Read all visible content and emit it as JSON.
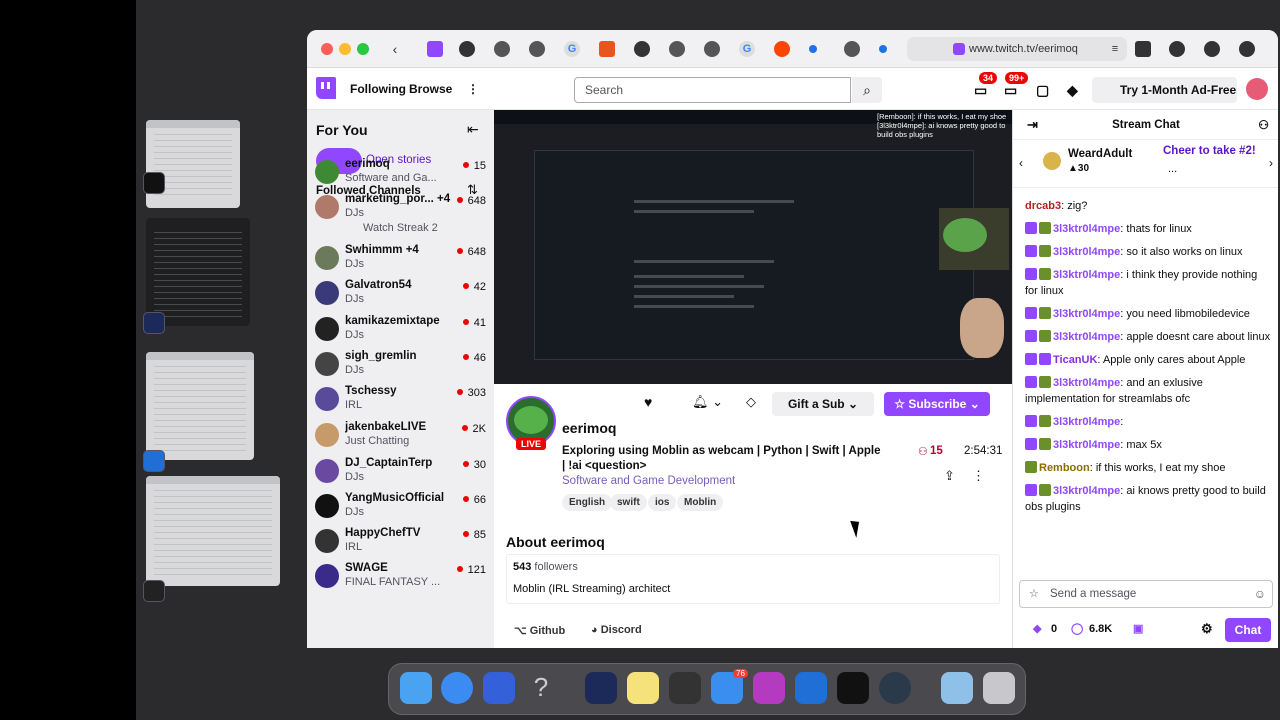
{
  "browser": {
    "url": "www.twitch.tv/eerimoq"
  },
  "nav": {
    "following": "Following",
    "browse": "Browse",
    "search_placeholder": "Search",
    "notif_badge": "34",
    "whispers_badge": "99+",
    "ad_free": "Try 1-Month Ad-Free"
  },
  "sidebar": {
    "title": "For You",
    "open_stories": "Open stories",
    "followed": "Followed Channels",
    "channels": [
      {
        "name": "eerimoq",
        "cat": "Software and Ga...",
        "viewers": "15",
        "color": "#3e8a34"
      },
      {
        "name": "marketing_por... +4",
        "cat": "DJs",
        "viewers": "648",
        "color": "#b07a6a"
      },
      {
        "name": "Swhimmm +4",
        "cat": "DJs",
        "viewers": "648",
        "color": "#6a7a5a"
      },
      {
        "name": "Galvatron54",
        "cat": "DJs",
        "viewers": "42",
        "color": "#3a3a7a"
      },
      {
        "name": "kamikazemixtape",
        "cat": "DJs",
        "viewers": "41",
        "color": "#222"
      },
      {
        "name": "sigh_gremlin",
        "cat": "DJs",
        "viewers": "46",
        "color": "#444"
      },
      {
        "name": "Tschessy",
        "cat": "IRL",
        "viewers": "303",
        "color": "#5a4a9a"
      },
      {
        "name": "jakenbakeLIVE",
        "cat": "Just Chatting",
        "viewers": "2K",
        "color": "#c79a6a"
      },
      {
        "name": "DJ_CaptainTerp",
        "cat": "DJs",
        "viewers": "30",
        "color": "#6a4aa0"
      },
      {
        "name": "YangMusicOfficial",
        "cat": "DJs",
        "viewers": "66",
        "color": "#111"
      },
      {
        "name": "HappyChefTV",
        "cat": "IRL",
        "viewers": "85",
        "color": "#333"
      },
      {
        "name": "SWAGE",
        "cat": "FINAL FANTASY ...",
        "viewers": "121",
        "color": "#3a2a8a"
      }
    ],
    "watch_streak": "Watch Streak 2"
  },
  "stream": {
    "overlay": "[Remboon]: if this works, I eat my shoe [3l3ktr0l4mpe]: ai knows pretty good to build obs plugins",
    "channel": "eerimoq",
    "live": "LIVE",
    "title": "Exploring using Moblin as webcam | Python | Swift | Apple | !ai <question>",
    "category": "Software and Game Development",
    "tags": [
      "English",
      "swift",
      "ios",
      "Moblin"
    ],
    "gift": "Gift a Sub",
    "subscribe": "Subscribe",
    "viewers": "15",
    "uptime": "2:54:31",
    "about_title": "About eerimoq",
    "followers_count": "543",
    "followers_label": "followers",
    "bio": "Moblin (IRL Streaming) architect",
    "github": "Github",
    "discord": "Discord"
  },
  "chat": {
    "title": "Stream Chat",
    "pinned_user": "WeardAdult",
    "pinned_count": "30",
    "cheer": "Cheer to take #2!",
    "cheer_more": "...",
    "messages": [
      {
        "user": "drcab3",
        "color": "#b22222",
        "text": "zig?",
        "badges": ""
      },
      {
        "user": "3l3ktr0l4mpe",
        "color": "#9147ff",
        "text": "thats for linux",
        "badges": "pg"
      },
      {
        "user": "3l3ktr0l4mpe",
        "color": "#9147ff",
        "text": "so it also works on linux",
        "badges": "pg"
      },
      {
        "user": "3l3ktr0l4mpe",
        "color": "#9147ff",
        "text": "i think they provide nothing for linux",
        "badges": "pg"
      },
      {
        "user": "3l3ktr0l4mpe",
        "color": "#9147ff",
        "text": "you need libmobiledevice",
        "badges": "pg"
      },
      {
        "user": "3l3ktr0l4mpe",
        "color": "#9147ff",
        "text": "apple doesnt care about linux",
        "badges": "pg"
      },
      {
        "user": "TicanUK",
        "color": "#8a2be2",
        "text": "Apple only cares about Apple",
        "badges": "pp"
      },
      {
        "user": "3l3ktr0l4mpe",
        "color": "#9147ff",
        "text": "and an exlusive implementation for streamlabs ofc",
        "badges": "pg"
      },
      {
        "user": "3l3ktr0l4mpe",
        "color": "#9147ff",
        "text": "",
        "badges": "pg"
      },
      {
        "user": "3l3ktr0l4mpe",
        "color": "#9147ff",
        "text": "max 5x",
        "badges": "pg"
      },
      {
        "user": "Remboon",
        "color": "#8a6d00",
        "text": "if this works, I eat my shoe",
        "badges": "g"
      },
      {
        "user": "3l3ktr0l4mpe",
        "color": "#9147ff",
        "text": "ai knows pretty good to build obs plugins",
        "badges": "pg"
      }
    ],
    "input_placeholder": "Send a message",
    "points": "0",
    "bits": "6.8K",
    "chat_button": "Chat"
  },
  "dock": {
    "mail_badge": "76"
  }
}
